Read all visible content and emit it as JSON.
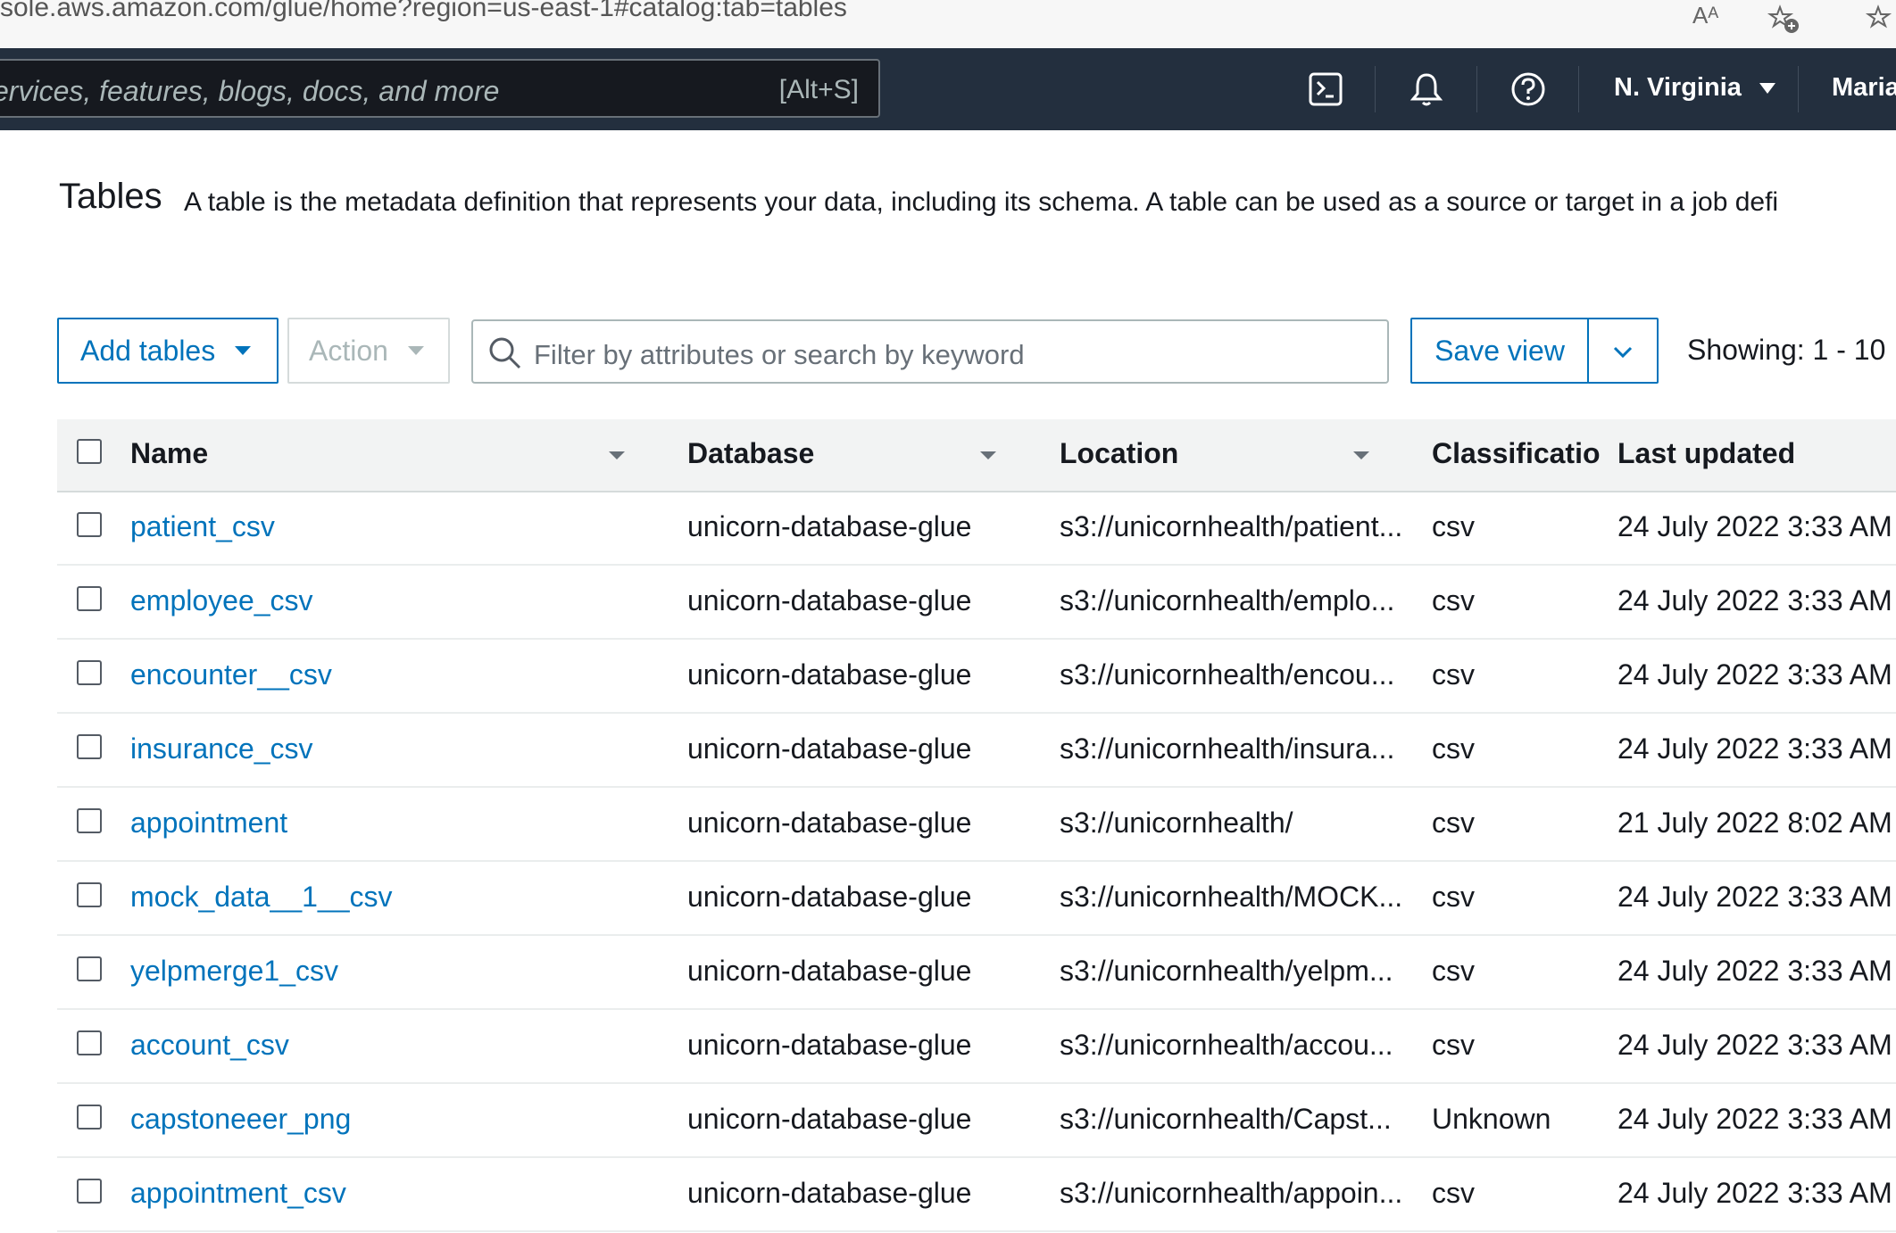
{
  "browser": {
    "url": "sole.aws.amazon.com/glue/home?region=us-east-1#catalog:tab=tables",
    "read_aloud_label": "Aᴬ"
  },
  "topnav": {
    "search_placeholder": "ervices, features, blogs, docs, and more",
    "search_shortcut": "[Alt+S]",
    "region": "N. Virginia",
    "user": "Maria"
  },
  "header": {
    "title": "Tables",
    "description": "A table is the metadata definition that represents your data, including its schema. A table can be used as a source or target in a job defi"
  },
  "toolbar": {
    "add_tables": "Add tables",
    "action": "Action",
    "filter_placeholder": "Filter by attributes or search by keyword",
    "save_view": "Save view",
    "showing": "Showing: 1 - 10"
  },
  "table": {
    "columns": [
      "Name",
      "Database",
      "Location",
      "Classificatio",
      "Last updated"
    ],
    "rows": [
      {
        "name": "patient_csv",
        "database": "unicorn-database-glue",
        "location": "s3://unicornhealth/patient...",
        "classification": "csv",
        "updated": "24 July 2022 3:33 AM"
      },
      {
        "name": "employee_csv",
        "database": "unicorn-database-glue",
        "location": "s3://unicornhealth/emplo...",
        "classification": "csv",
        "updated": "24 July 2022 3:33 AM"
      },
      {
        "name": "encounter__csv",
        "database": "unicorn-database-glue",
        "location": "s3://unicornhealth/encou...",
        "classification": "csv",
        "updated": "24 July 2022 3:33 AM"
      },
      {
        "name": "insurance_csv",
        "database": "unicorn-database-glue",
        "location": "s3://unicornhealth/insura...",
        "classification": "csv",
        "updated": "24 July 2022 3:33 AM"
      },
      {
        "name": "appointment",
        "database": "unicorn-database-glue",
        "location": "s3://unicornhealth/",
        "classification": "csv",
        "updated": "21 July 2022 8:02 AM"
      },
      {
        "name": "mock_data__1__csv",
        "database": "unicorn-database-glue",
        "location": "s3://unicornhealth/MOCK...",
        "classification": "csv",
        "updated": "24 July 2022 3:33 AM"
      },
      {
        "name": "yelpmerge1_csv",
        "database": "unicorn-database-glue",
        "location": "s3://unicornhealth/yelpm...",
        "classification": "csv",
        "updated": "24 July 2022 3:33 AM"
      },
      {
        "name": "account_csv",
        "database": "unicorn-database-glue",
        "location": "s3://unicornhealth/accou...",
        "classification": "csv",
        "updated": "24 July 2022 3:33 AM"
      },
      {
        "name": "capstoneeer_png",
        "database": "unicorn-database-glue",
        "location": "s3://unicornhealth/Capst...",
        "classification": "Unknown",
        "updated": "24 July 2022 3:33 AM"
      },
      {
        "name": "appointment_csv",
        "database": "unicorn-database-glue",
        "location": "s3://unicornhealth/appoin...",
        "classification": "csv",
        "updated": "24 July 2022 3:33 AM"
      }
    ]
  }
}
